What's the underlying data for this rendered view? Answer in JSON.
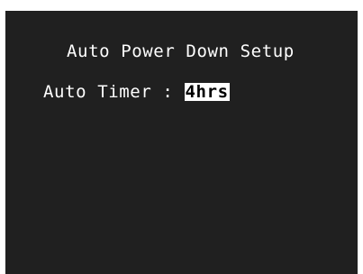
{
  "screen": {
    "title": "Auto Power Down Setup",
    "auto_timer": {
      "label": "Auto Timer",
      "separator": " : ",
      "value": "4hrs"
    }
  },
  "colors": {
    "screen_background": "#202020",
    "text": "#ffffff",
    "selected_background": "#ffffff",
    "selected_text": "#000000"
  }
}
